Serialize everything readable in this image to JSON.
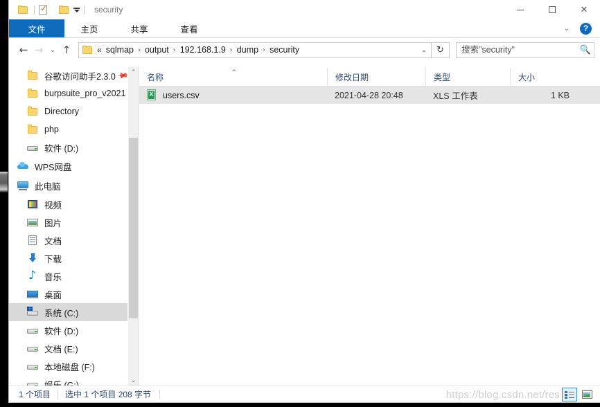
{
  "window": {
    "title": "security",
    "quick_access": {
      "folder_icon": "folder-icon",
      "properties_icon": "properties-checkmark-icon",
      "new_folder_icon": "new-folder-icon",
      "customize_caret": "chevron-down-icon"
    },
    "controls": {
      "minimize": "—",
      "maximize": "□",
      "close": "✕"
    }
  },
  "ribbon": {
    "tabs": [
      {
        "label": "文件",
        "active": true
      },
      {
        "label": "主页",
        "active": false
      },
      {
        "label": "共享",
        "active": false
      },
      {
        "label": "查看",
        "active": false
      }
    ],
    "collapse_icon": "chevron-down-icon",
    "help_label": "?"
  },
  "nav": {
    "back_icon": "arrow-left-icon",
    "forward_icon": "arrow-right-icon",
    "recent_icon": "chevron-down-icon",
    "up_icon": "arrow-up-icon",
    "address": {
      "folder_icon": "folder-icon",
      "overflow": "«",
      "crumbs": [
        "sqlmap",
        "output",
        "192.168.1.9",
        "dump",
        "security"
      ],
      "separator": "›",
      "dropdown_icon": "chevron-down-icon"
    },
    "refresh_icon": "↻",
    "search": {
      "placeholder": "搜索\"security\"",
      "value": "",
      "icon": "search-icon"
    }
  },
  "sidebar": {
    "items": [
      {
        "label": "谷歌访问助手2.3.0",
        "icon": "folder-icon",
        "pinned": true,
        "selected": false,
        "level": "sub"
      },
      {
        "label": "burpsuite_pro_v2021",
        "icon": "folder-icon",
        "pinned": false,
        "selected": false,
        "level": "sub"
      },
      {
        "label": "Directory",
        "icon": "folder-icon",
        "pinned": false,
        "selected": false,
        "level": "sub"
      },
      {
        "label": "php",
        "icon": "folder-icon",
        "pinned": false,
        "selected": false,
        "level": "sub"
      },
      {
        "label": "软件 (D:)",
        "icon": "drive-icon",
        "pinned": false,
        "selected": false,
        "level": "sub"
      },
      {
        "label": "WPS网盘",
        "icon": "cloud-icon",
        "pinned": false,
        "selected": false,
        "level": "root"
      },
      {
        "label": "此电脑",
        "icon": "this-pc-icon",
        "pinned": false,
        "selected": false,
        "level": "root"
      },
      {
        "label": "视频",
        "icon": "video-icon",
        "pinned": false,
        "selected": false,
        "level": "sub"
      },
      {
        "label": "图片",
        "icon": "picture-icon",
        "pinned": false,
        "selected": false,
        "level": "sub"
      },
      {
        "label": "文档",
        "icon": "document-icon",
        "pinned": false,
        "selected": false,
        "level": "sub"
      },
      {
        "label": "下载",
        "icon": "download-icon",
        "pinned": false,
        "selected": false,
        "level": "sub"
      },
      {
        "label": "音乐",
        "icon": "music-icon",
        "pinned": false,
        "selected": false,
        "level": "sub"
      },
      {
        "label": "桌面",
        "icon": "desktop-icon",
        "pinned": false,
        "selected": false,
        "level": "sub"
      },
      {
        "label": "系统 (C:)",
        "icon": "system-drive-icon",
        "pinned": false,
        "selected": true,
        "level": "sub"
      },
      {
        "label": "软件 (D:)",
        "icon": "drive-icon",
        "pinned": false,
        "selected": false,
        "level": "sub"
      },
      {
        "label": "文档 (E:)",
        "icon": "drive-icon",
        "pinned": false,
        "selected": false,
        "level": "sub"
      },
      {
        "label": "本地磁盘 (F:)",
        "icon": "drive-icon",
        "pinned": false,
        "selected": false,
        "level": "sub"
      },
      {
        "label": "娱乐 (G:)",
        "icon": "drive-icon",
        "pinned": false,
        "selected": false,
        "level": "sub"
      }
    ],
    "scroll_up_icon": "chevron-up-icon",
    "scroll_down_icon": "chevron-down-icon"
  },
  "filelist": {
    "columns": [
      {
        "label": "名称",
        "sorted": "asc"
      },
      {
        "label": "修改日期",
        "sorted": ""
      },
      {
        "label": "类型",
        "sorted": ""
      },
      {
        "label": "大小",
        "sorted": ""
      }
    ],
    "sort_caret": "^",
    "rows": [
      {
        "name": "users.csv",
        "icon": "csv-file-icon",
        "icon_glyph": "X",
        "date": "2021-04-28 20:48",
        "type": "XLS 工作表",
        "size": "1 KB",
        "selected": true
      }
    ]
  },
  "statusbar": {
    "item_count": "1 个项目",
    "selection": "选中 1 个项目  208 字节",
    "views": [
      {
        "name": "details-view",
        "active": true
      },
      {
        "name": "large-icons-view",
        "active": false
      }
    ]
  },
  "watermark": "https://blog.csdn.net/res"
}
